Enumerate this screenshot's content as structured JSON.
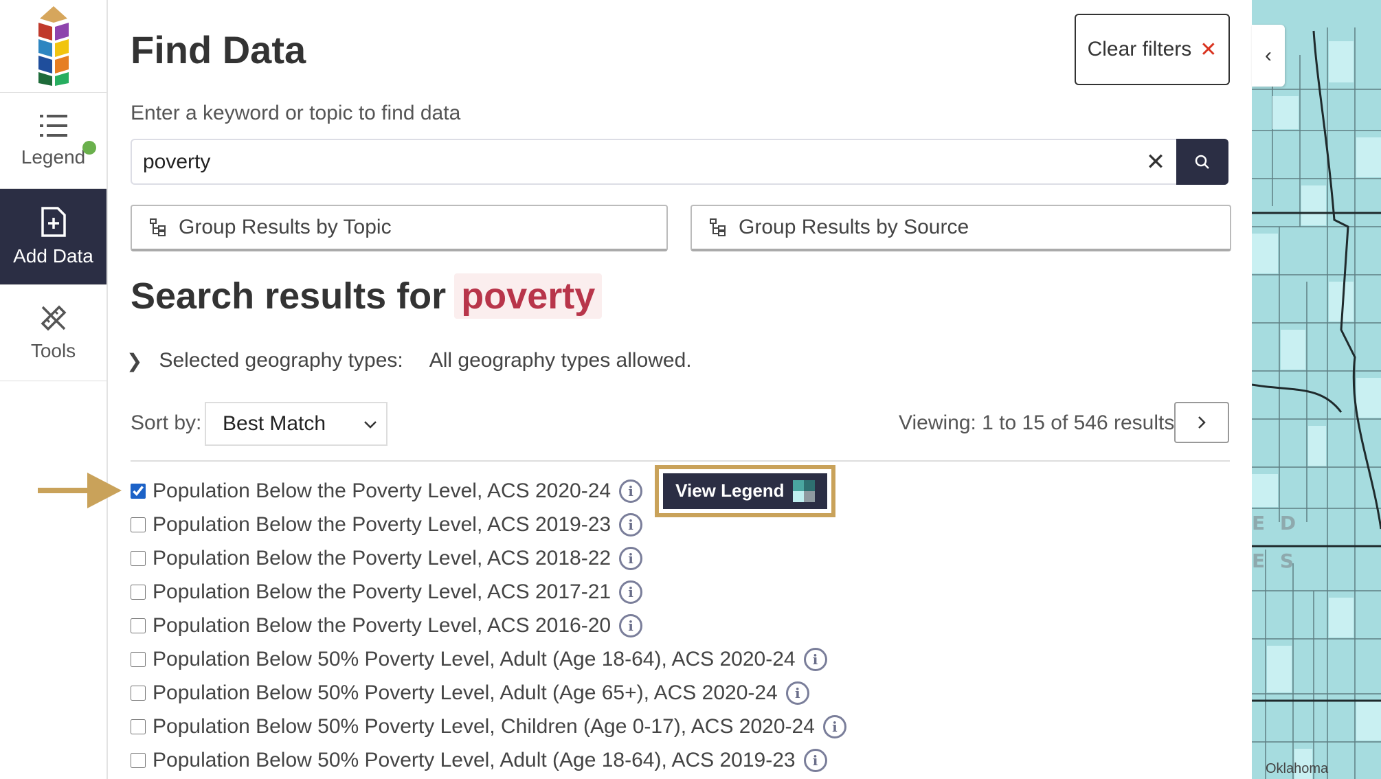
{
  "sidebar": {
    "items": [
      {
        "label": "Legend",
        "icon": "list-icon",
        "has_status_dot": true
      },
      {
        "label": "Add Data",
        "icon": "add-file-icon",
        "active": true
      },
      {
        "label": "Tools",
        "icon": "ruler-pencil-icon"
      }
    ]
  },
  "header": {
    "title": "Find Data",
    "clear_filters_label": "Clear filters"
  },
  "search": {
    "prompt": "Enter a keyword or topic to find data",
    "value": "poverty"
  },
  "group_buttons": {
    "by_topic": "Group Results by Topic",
    "by_source": "Group Results by Source"
  },
  "results": {
    "heading_prefix": "Search results for",
    "query": "poverty",
    "geo_label": "Selected geography types:",
    "geo_value": "All geography types allowed.",
    "sort_label": "Sort by:",
    "sort_value": "Best Match",
    "viewing": "Viewing: 1 to 15 of 546 results",
    "view_legend_label": "View Legend",
    "items": [
      {
        "label": "Population Below the Poverty Level, ACS 2020-24",
        "checked": true
      },
      {
        "label": "Population Below the Poverty Level, ACS 2019-23",
        "checked": false
      },
      {
        "label": "Population Below the Poverty Level, ACS 2018-22",
        "checked": false
      },
      {
        "label": "Population Below the Poverty Level, ACS 2017-21",
        "checked": false
      },
      {
        "label": "Population Below the Poverty Level, ACS 2016-20",
        "checked": false
      },
      {
        "label": "Population Below 50% Poverty Level, Adult (Age 18-64), ACS 2020-24",
        "checked": false
      },
      {
        "label": "Population Below 50% Poverty Level, Adult (Age 65+), ACS 2020-24",
        "checked": false
      },
      {
        "label": "Population Below 50% Poverty Level, Children (Age 0-17), ACS 2020-24",
        "checked": false
      },
      {
        "label": "Population Below 50% Poverty Level, Adult (Age 18-64), ACS 2019-23",
        "checked": false
      }
    ]
  },
  "map": {
    "labels": [
      "E D",
      "E S"
    ],
    "state_label": "Oklahoma"
  },
  "colors": {
    "nav_dark": "#2b2e44",
    "accent_gold": "#c9a25a",
    "query_red": "#b8354a",
    "map_teal": "#a6dcdf"
  }
}
